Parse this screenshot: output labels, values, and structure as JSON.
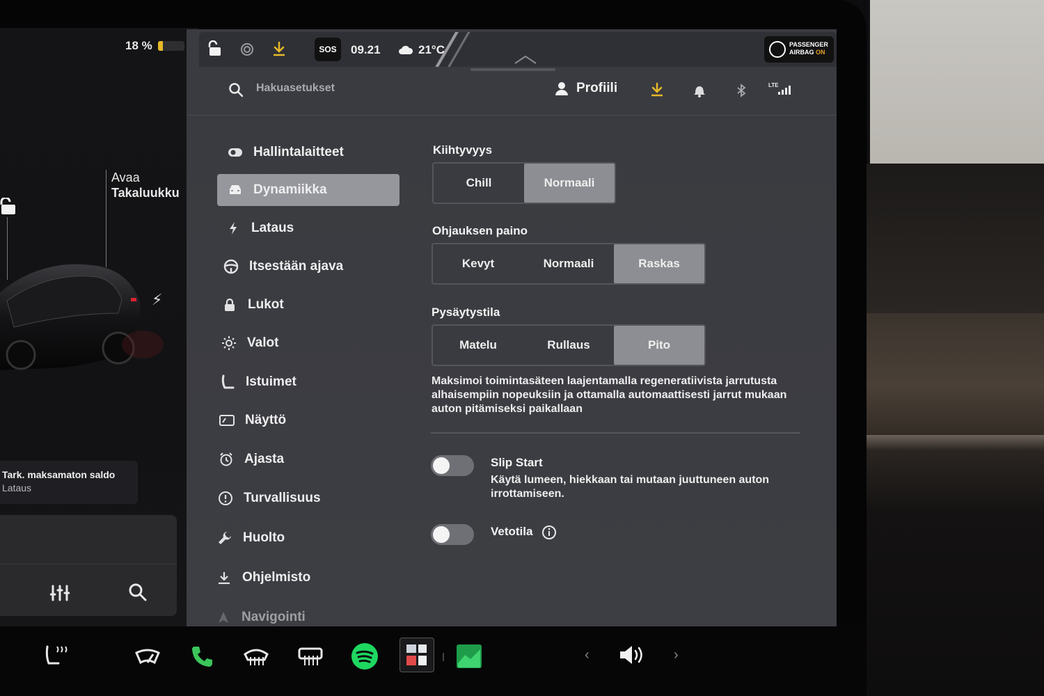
{
  "status": {
    "battery_percent": "18 %",
    "battery_level": 0.18,
    "time": "09.21",
    "temperature": "21°C",
    "sos_label": "SOS",
    "airbag_line1": "PASSENGER",
    "airbag_line2": "AIRBAG",
    "airbag_state": "ON"
  },
  "car": {
    "trunk_line1": "Avaa",
    "trunk_line2": "Takaluukku",
    "balance_title": "Tark. maksamaton saldo",
    "balance_sub": "Lataus"
  },
  "header": {
    "search_placeholder": "Hakuasetukset",
    "profile_label": "Profiili",
    "signal_label": "LTE"
  },
  "sidebar": {
    "items": [
      {
        "label": "Hallintalaitteet",
        "icon": "toggle-icon",
        "active": false
      },
      {
        "label": "Dynamiikka",
        "icon": "car-icon",
        "active": true
      },
      {
        "label": "Lataus",
        "icon": "bolt-icon",
        "active": false
      },
      {
        "label": "Itsestään ajava",
        "icon": "steering-wheel-icon",
        "active": false
      },
      {
        "label": "Lukot",
        "icon": "lock-icon",
        "active": false
      },
      {
        "label": "Valot",
        "icon": "sun-icon",
        "active": false
      },
      {
        "label": "Istuimet",
        "icon": "seat-icon",
        "active": false
      },
      {
        "label": "Näyttö",
        "icon": "display-icon",
        "active": false
      },
      {
        "label": "Ajasta",
        "icon": "alarm-icon",
        "active": false
      },
      {
        "label": "Turvallisuus",
        "icon": "info-circle-icon",
        "active": false
      },
      {
        "label": "Huolto",
        "icon": "wrench-icon",
        "active": false
      },
      {
        "label": "Ohjelmisto",
        "icon": "download-icon",
        "active": false
      },
      {
        "label": "Navigointi",
        "icon": "navigation-icon",
        "active": false
      }
    ]
  },
  "acceleration": {
    "title": "Kiihtyvyys",
    "options": [
      "Chill",
      "Normaali"
    ],
    "selected": "Normaali"
  },
  "steering": {
    "title": "Ohjauksen paino",
    "options": [
      "Kevyt",
      "Normaali",
      "Raskas"
    ],
    "selected": "Raskas"
  },
  "stop_mode": {
    "title": "Pysäytystila",
    "options": [
      "Matelu",
      "Rullaus",
      "Pito"
    ],
    "selected": "Pito",
    "description": "Maksimoi toimintasäteen laajentamalla regeneratiivista jarrutusta alhaisempiin nopeuksiin ja ottamalla automaattisesti jarrut mukaan auton pitämiseksi paikallaan"
  },
  "slip_start": {
    "title": "Slip Start",
    "description": "Käytä lumeen, hiekkaan tai mutaan juuttuneen auton irrottamiseen.",
    "enabled": false
  },
  "traction": {
    "title": "Vetotila",
    "enabled": false
  },
  "colors": {
    "accent_download": "#e7b928",
    "phone_green": "#3bc55a",
    "spotify_green": "#1ed760",
    "airbag_on": "#e8a22a"
  }
}
